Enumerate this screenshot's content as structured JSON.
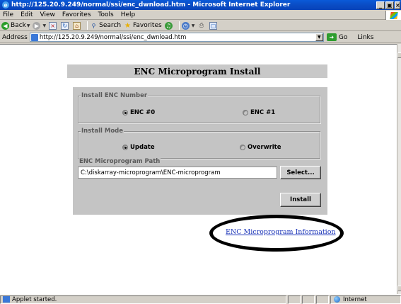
{
  "window": {
    "title": "http://125.20.9.249/normal/ssi/enc_dwnload.htm - Microsoft Internet Explorer",
    "minimize": "_",
    "maximize": "б",
    "close": "×"
  },
  "menu": [
    "File",
    "Edit",
    "View",
    "Favorites",
    "Tools",
    "Help"
  ],
  "toolbar": {
    "back": "Back",
    "search": "Search",
    "favorites": "Favorites"
  },
  "address": {
    "label": "Address",
    "url": "http://125.20.9.249/normal/ssi/enc_dwnload.htm",
    "go": "Go",
    "links": "Links"
  },
  "page": {
    "heading": "ENC Microprogram Install",
    "install_number": {
      "legend": "Install ENC Number",
      "options": [
        "ENC #0",
        "ENC #1"
      ],
      "selected": "ENC #0"
    },
    "install_mode": {
      "legend": "Install Mode",
      "options": [
        "Update",
        "Overwrite"
      ],
      "selected": "Update"
    },
    "path": {
      "legend": "ENC Microprogram Path",
      "value": "C:\\diskarray-microprogram\\ENC-microprogram",
      "select_label": "Select..."
    },
    "install_label": "Install",
    "info_link": "ENC Microprogram Information"
  },
  "status": {
    "text": "Applet started.",
    "zone": "Internet"
  }
}
